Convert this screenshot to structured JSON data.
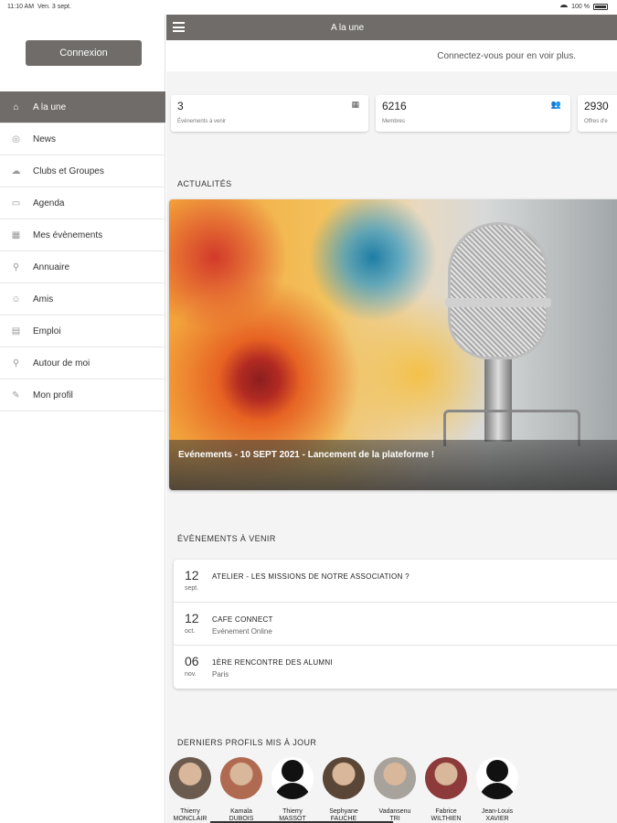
{
  "status_bar": {
    "time": "11:10 AM",
    "date": "Ven. 3 sept.",
    "battery": "100 %"
  },
  "sidebar": {
    "login_label": "Connexion",
    "items": [
      {
        "label": "A la une",
        "icon": "home-icon",
        "glyph": "⌂",
        "active": true
      },
      {
        "label": "News",
        "icon": "globe-icon",
        "glyph": "◎"
      },
      {
        "label": "Clubs et Groupes",
        "icon": "groups-icon",
        "glyph": "☁"
      },
      {
        "label": "Agenda",
        "icon": "book-icon",
        "glyph": "▭"
      },
      {
        "label": "Mes évènements",
        "icon": "calendar-icon",
        "glyph": "▦"
      },
      {
        "label": "Annuaire",
        "icon": "search-icon",
        "glyph": "⚲"
      },
      {
        "label": "Amis",
        "icon": "person-icon",
        "glyph": "☺"
      },
      {
        "label": "Emploi",
        "icon": "briefcase-icon",
        "glyph": "▤"
      },
      {
        "label": "Autour de moi",
        "icon": "map-pin-icon",
        "glyph": "⚲"
      },
      {
        "label": "Mon profil",
        "icon": "edit-icon",
        "glyph": "✎"
      }
    ]
  },
  "header": {
    "title": "A la une"
  },
  "login_prompt": "Connectez-vous pour en voir plus.",
  "stats": [
    {
      "value": "3",
      "label": "Événements à venir",
      "icon": "calendar-icon",
      "glyph": "▦"
    },
    {
      "value": "6216",
      "label": "Membres",
      "icon": "members-icon",
      "glyph": "👥"
    },
    {
      "value": "2930",
      "label": "Offres d'e",
      "icon": "",
      "glyph": ""
    }
  ],
  "news_section": {
    "title": "ACTUALITÉS",
    "caption": "Evénements - 10 SEPT 2021 - Lancement de la plateforme !"
  },
  "events_section": {
    "title": "ÉVÈNEMENTS À VENIR",
    "items": [
      {
        "day": "12",
        "month": "sept.",
        "title": "ATELIER - LES MISSIONS DE NOTRE ASSOCIATION ?",
        "subtitle": ""
      },
      {
        "day": "12",
        "month": "oct.",
        "title": "CAFE CONNECT",
        "subtitle": "Evénement Online"
      },
      {
        "day": "06",
        "month": "nov.",
        "title": "1ÈRE RENCONTRE DES ALUMNI",
        "subtitle": "Paris"
      }
    ]
  },
  "profiles_section": {
    "title": "DERNIERS PROFILS MIS À JOUR",
    "items": [
      {
        "first": "Thierry",
        "last": "MONCLAIR",
        "photo": "#6b5a4e"
      },
      {
        "first": "Kamala",
        "last": "DUBOIS",
        "photo": "#b06a52"
      },
      {
        "first": "Thierry",
        "last": "MASSOT",
        "photo": "silhouette"
      },
      {
        "first": "Sephyane",
        "last": "FAUCHE",
        "photo": "#5a4636"
      },
      {
        "first": "Vadansenu",
        "last": "TRI",
        "photo": "#a8a29c"
      },
      {
        "first": "Fabrice",
        "last": "WILTHIEN",
        "photo": "#8c3a3a"
      },
      {
        "first": "Jean-Louis",
        "last": "XAVIER",
        "photo": "silhouette"
      }
    ]
  }
}
